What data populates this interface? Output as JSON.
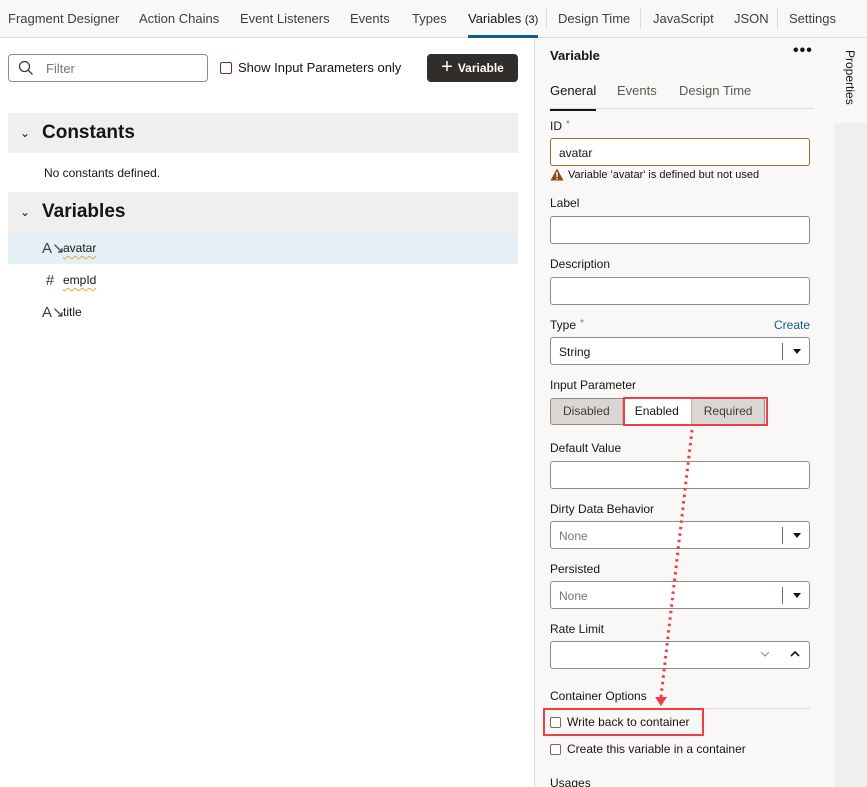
{
  "tabs": [
    {
      "label": "Fragment Designer"
    },
    {
      "label": "Action Chains"
    },
    {
      "label": "Event Listeners"
    },
    {
      "label": "Events"
    },
    {
      "label": "Types"
    },
    {
      "label": "Variables",
      "count": "(3)",
      "active": true
    },
    {
      "label": "Design Time"
    },
    {
      "label": "JavaScript"
    },
    {
      "label": "JSON"
    },
    {
      "label": "Settings"
    }
  ],
  "toolbar": {
    "filter_placeholder": "Filter",
    "show_input_params_label": "Show Input Parameters only",
    "add_variable_label": "Variable"
  },
  "constants": {
    "title": "Constants",
    "empty_message": "No constants defined."
  },
  "variables": {
    "title": "Variables",
    "items": [
      {
        "name": "avatar",
        "type_icon": "string-icon",
        "selected": true
      },
      {
        "name": "empId",
        "type_icon": "number-icon",
        "selected": false
      },
      {
        "name": "title",
        "type_icon": "string-icon",
        "selected": false
      }
    ]
  },
  "properties": {
    "title": "Variable",
    "more_label": "•••",
    "tabs": [
      "General",
      "Events",
      "Design Time"
    ],
    "active_tab": "General",
    "id_label": "ID",
    "required_mark": "*",
    "id_value": "avatar",
    "warning": "Variable 'avatar' is defined but not used",
    "label_label": "Label",
    "label_value": "",
    "description_label": "Description",
    "description_value": "",
    "type_label": "Type",
    "type_create_link": "Create",
    "type_value": "String",
    "input_param_label": "Input Parameter",
    "input_param_options": [
      "Disabled",
      "Enabled",
      "Required"
    ],
    "input_param_selected": "Enabled",
    "default_value_label": "Default Value",
    "default_value": "",
    "dirty_label": "Dirty Data Behavior",
    "dirty_value": "None",
    "persisted_label": "Persisted",
    "persisted_value": "None",
    "rate_limit_label": "Rate Limit",
    "rate_limit_value": "",
    "container_options_label": "Container Options",
    "write_back_label": "Write back to container",
    "write_back_checked": false,
    "create_in_container_label": "Create this variable in a container",
    "create_in_container_checked": false,
    "usages_label": "Usages"
  },
  "rail": {
    "properties_label": "Properties"
  },
  "colors": {
    "accent": "#0d6185",
    "highlight": "#ee3f44",
    "selected_row": "#e4f0f6",
    "warning_icon": "#8c4a10"
  }
}
